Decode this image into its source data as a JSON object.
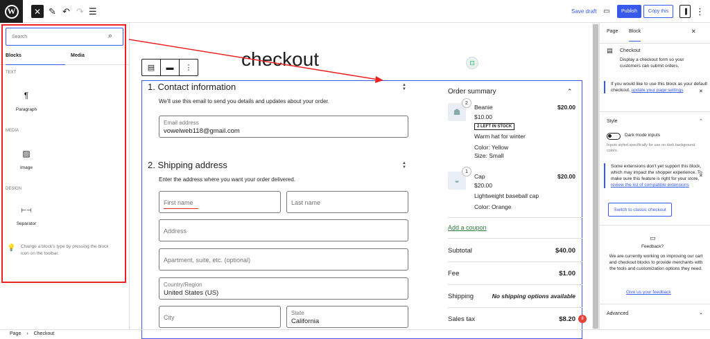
{
  "topbar": {
    "logo": "W",
    "close": "✕",
    "pen": "✎",
    "undo": "↶",
    "redo": "↷",
    "list": "☰",
    "save_draft": "Save draft",
    "publish": "Publish",
    "copy": "Copy this",
    "more": "⋮"
  },
  "inserter": {
    "search_placeholder": "Search",
    "search_icon": "⌕",
    "tabs": [
      "Blocks",
      "Media"
    ],
    "categories": [
      "TEXT",
      "MEDIA",
      "DESIGN"
    ],
    "blocks": [
      {
        "label": "Paragraph",
        "icon": "¶"
      },
      {
        "label": "Image",
        "icon": "▨"
      },
      {
        "label": "Separator",
        "icon": "⊢⊣"
      }
    ],
    "tip": "Change a block's type by pressing the block icon on the toolbar.",
    "tip_icon": "💡"
  },
  "page": {
    "title": "checkout"
  },
  "checkout": {
    "contact": {
      "title": "1.  Contact information",
      "desc": "We'll use this email to send you details and updates about your order.",
      "email_label": "Email address",
      "email_value": "vowelweb118@gmail.com"
    },
    "shipping": {
      "title": "2.  Shipping address",
      "desc": "Enter the address where you want your order delivered.",
      "first_name": "First name",
      "last_name": "Last name",
      "address": "Address",
      "apartment": "Apartment, suite, etc. (optional)",
      "country_label": "Country/Region",
      "country_value": "United States (US)",
      "city": "City",
      "state_label": "State",
      "state_value": "California"
    }
  },
  "summary": {
    "title": "Order summary",
    "chevron": "⌃",
    "items": [
      {
        "qty": "2",
        "name": "Beanie",
        "price": "$20.00",
        "unit": "$10.00",
        "stock": "2 LEFT IN STOCK",
        "desc": "Warm hat for winter",
        "attr1": "Color: Yellow",
        "attr2": "Size: Small"
      },
      {
        "qty": "1",
        "name": "Cap",
        "price": "$20.00",
        "unit": "$20.00",
        "desc": "Lightweight baseball cap",
        "attr1": "Color: Orange"
      }
    ],
    "coupon": "Add a coupon",
    "rows": [
      {
        "label": "Subtotal",
        "value": "$40.00"
      },
      {
        "label": "Fee",
        "value": "$1.00"
      },
      {
        "label": "Shipping",
        "value": "No shipping options available"
      },
      {
        "label": "Sales tax",
        "value": "$8.20"
      }
    ],
    "notif": "8"
  },
  "sidebar": {
    "tabs": [
      "Page",
      "Block"
    ],
    "close": "✕",
    "block_title": "Checkout",
    "block_desc": "Display a checkout form so your customers can submit orders.",
    "notice1": "If you would like to use this block as your default checkout,",
    "notice1_link": "update your page settings",
    "style_title": "Style",
    "dark_label": "Dark mode inputs",
    "dark_desc": "Inputs styled specifically for use on dark background colors.",
    "notice2": "Some extensions don't yet support this block, which may impact the shopper experience. To make sure this feature is right for your store,",
    "notice2_link": "review the list of compatible extensions",
    "classic_btn": "Switch to classic checkout",
    "feedback_title": "Feedback?",
    "feedback_desc": "We are currently working on improving our cart and checkout blocks to provide merchants with the tools and customization options they need.",
    "feedback_link": "Give us your feedback",
    "advanced": "Advanced"
  },
  "footer": {
    "crumb1": "Page",
    "sep": "›",
    "crumb2": "Checkout"
  }
}
